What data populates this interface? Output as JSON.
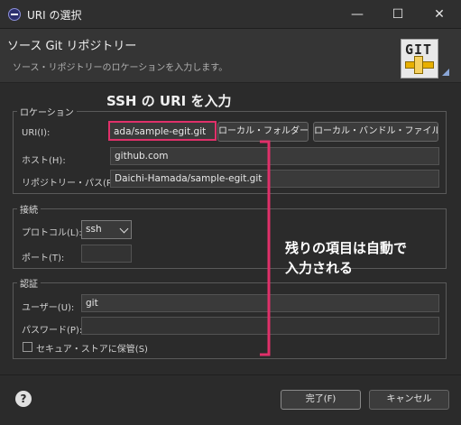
{
  "window": {
    "title": "URI の選択",
    "controls": {
      "minimize": "—",
      "maximize": "☐",
      "close": "✕"
    }
  },
  "header": {
    "title": "ソース Git リポジトリー",
    "description": "ソース・リポジトリーのロケーションを入力します。",
    "logo_text": "GIT"
  },
  "location": {
    "legend": "ロケーション",
    "uri_label": "URI(I):",
    "uri_value": "ada/sample-egit.git",
    "local_folder_button": "ローカル・フォルダー...",
    "local_bundle_button": "ローカル・バンドル・ファイル...",
    "host_label": "ホスト(H):",
    "host_value": "github.com",
    "repo_path_label": "リポジトリー・パス(R):",
    "repo_path_value": "Daichi-Hamada/sample-egit.git"
  },
  "connection": {
    "legend": "接続",
    "protocol_label": "プロトコル(L):",
    "protocol_value": "ssh",
    "port_label": "ポート(T):",
    "port_value": ""
  },
  "auth": {
    "legend": "認証",
    "user_label": "ユーザー(U):",
    "user_value": "git",
    "password_label": "パスワード(P):",
    "password_value": "",
    "secure_store_label": "セキュア・ストアに保管(S)"
  },
  "annotations": {
    "ssh_uri": "SSH の URI を入力",
    "auto_filled_line1": "残りの項目は自動で",
    "auto_filled_line2": "入力される",
    "accent_color": "#e0306a"
  },
  "footer": {
    "help_icon": "?",
    "finish_button": "完了(F)",
    "cancel_button": "キャンセル"
  }
}
